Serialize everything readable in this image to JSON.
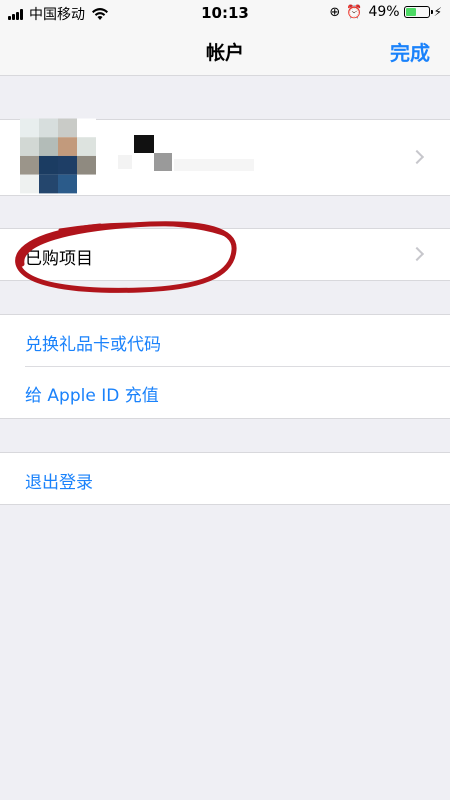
{
  "status_bar": {
    "carrier": "中国移动",
    "time": "10:13",
    "battery": "49%",
    "battery_level": 0.49
  },
  "nav": {
    "title": "帐户",
    "done": "完成"
  },
  "purchased": {
    "label": "已购项目"
  },
  "redeem": {
    "gift_card": "兑换礼品卡或代码",
    "add_funds": "给 Apple ID 充值"
  },
  "signout": {
    "label": "退出登录"
  },
  "colors": {
    "accent": "#1a82fb",
    "background": "#efeff4",
    "annotation": "#b0141b"
  }
}
